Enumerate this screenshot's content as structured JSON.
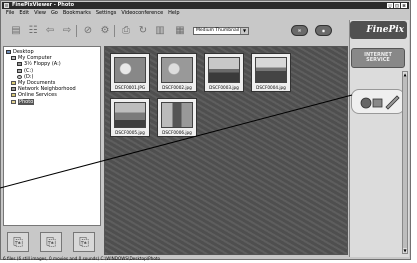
{
  "window": {
    "title": "FinePixViewer - Photo",
    "controls": [
      "_",
      "□",
      "×"
    ]
  },
  "menu": [
    "File",
    "Edit",
    "View",
    "Go",
    "Bookmarks",
    "Settings",
    "Videoconference",
    "Help"
  ],
  "toolbar": {
    "view_mode": "Medium Thumbnail"
  },
  "tree": [
    {
      "label": "Desktop",
      "icon": "desktop-icon",
      "indent": 0
    },
    {
      "label": "My Computer",
      "icon": "computer-icon",
      "indent": 1
    },
    {
      "label": "3½ Floppy (A:)",
      "icon": "floppy-icon",
      "indent": 2
    },
    {
      "label": "(C:)",
      "icon": "drive-icon",
      "indent": 2
    },
    {
      "label": "(D:)",
      "icon": "cdrom-icon",
      "indent": 2
    },
    {
      "label": "My Documents",
      "icon": "folder-icon",
      "indent": 1
    },
    {
      "label": "Network Neighborhood",
      "icon": "network-icon",
      "indent": 1
    },
    {
      "label": "Online Services",
      "icon": "folder-icon",
      "indent": 1
    },
    {
      "label": "Photo",
      "icon": "folder-open-icon",
      "indent": 1,
      "selected": true
    }
  ],
  "thumbnails": [
    {
      "caption": "DSCF0001.JPG",
      "scene": "people"
    },
    {
      "caption": "DSCF0002.jpg",
      "scene": "people"
    },
    {
      "caption": "DSCF0003.jpg",
      "scene": "landscape"
    },
    {
      "caption": "DSCF0004.jpg",
      "scene": "landscape"
    },
    {
      "caption": "DSCF0005.jpg",
      "scene": "building"
    },
    {
      "caption": "DSCF0006.jpg",
      "scene": "building"
    }
  ],
  "right_panel": {
    "logo": "FinePix",
    "service_button": "INTERNET SERVICE"
  },
  "status": "6 files (6 still images, 0 movies and 0 sounds)  C:\\WINDOWS\\Desktop\\Photo",
  "colors": {
    "window_bg": "#c8c8c8",
    "title_bg": "#2a2a2a",
    "thumb_area_bg": "#585858"
  }
}
